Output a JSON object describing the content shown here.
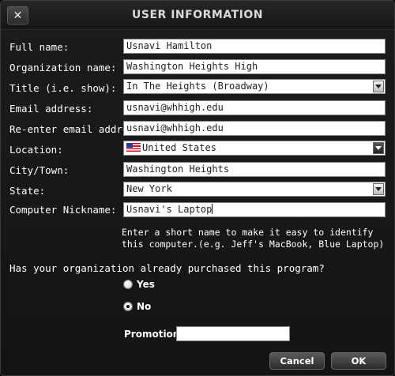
{
  "window": {
    "title": "USER INFORMATION",
    "close_symbol": "✕"
  },
  "form": {
    "full_name": {
      "label": "Full name:",
      "value": "Usnavi Hamilton"
    },
    "organization": {
      "label": "Organization name:",
      "value": "Washington Heights High"
    },
    "title": {
      "label": "Title (i.e. show):",
      "value": "In The Heights (Broadway)"
    },
    "email": {
      "label": "Email address:",
      "value": "usnavi@whhigh.edu"
    },
    "email_confirm": {
      "label": "Re-enter email address:",
      "value": "usnavi@whhigh.edu"
    },
    "location": {
      "label": "Location:",
      "value": "United States",
      "icon": "us-flag-icon"
    },
    "city": {
      "label": "City/Town:",
      "value": "Washington Heights"
    },
    "state": {
      "label": "State:",
      "value": "New York"
    },
    "nickname": {
      "label": "Computer Nickname:",
      "value": "Usnavi's Laptop"
    },
    "nickname_help": "Enter a short name to make it easy to identify this computer.(e.g. Jeff's MacBook, Blue Laptop)"
  },
  "purchase": {
    "question": "Has your organization already purchased this program?",
    "options": [
      {
        "label": "Yes",
        "checked": false
      },
      {
        "label": "No",
        "checked": true
      }
    ],
    "promotion_label": "Promotion:",
    "promotion_value": ""
  },
  "buttons": {
    "cancel": "Cancel",
    "ok": "OK"
  }
}
